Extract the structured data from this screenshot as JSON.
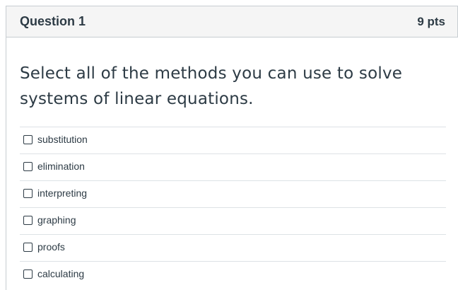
{
  "question": {
    "title": "Question 1",
    "points": "9 pts",
    "prompt_line_1": "Select all of the methods you can use to solve",
    "prompt_line_2": "systems of linear equations."
  },
  "answers": [
    {
      "label": "substitution",
      "checked": false
    },
    {
      "label": "elimination",
      "checked": false
    },
    {
      "label": "interpreting",
      "checked": false
    },
    {
      "label": "graphing",
      "checked": false
    },
    {
      "label": "proofs",
      "checked": false
    },
    {
      "label": "calculating",
      "checked": false
    }
  ],
  "colors": {
    "header_bg": "#f5f5f5",
    "border": "#c7cdd1",
    "text": "#2d3b45"
  }
}
